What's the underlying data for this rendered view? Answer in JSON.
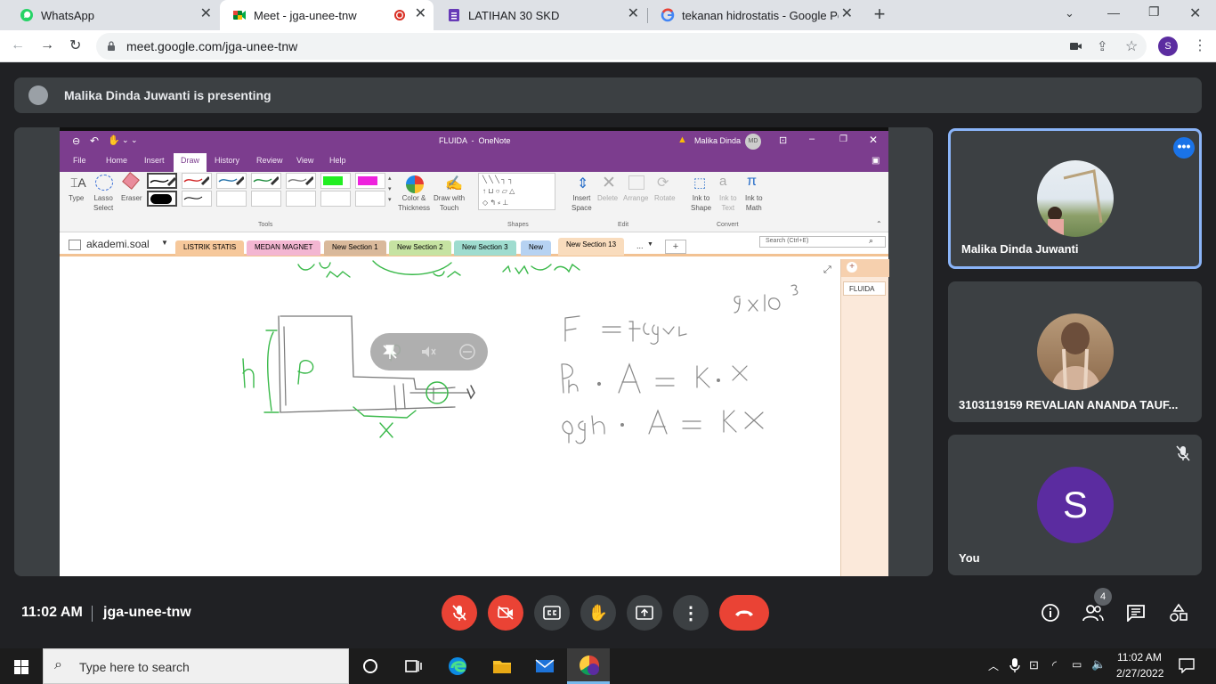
{
  "browser": {
    "tabs": [
      {
        "title": "WhatsApp",
        "icon": "whatsapp-icon"
      },
      {
        "title": "Meet - jga-unee-tnw",
        "icon": "google-meet-icon",
        "active": true,
        "recording": true
      },
      {
        "title": "LATIHAN 30 SKD",
        "icon": "google-forms-icon"
      },
      {
        "title": "tekanan hidrostatis - Google Pen",
        "icon": "google-icon"
      }
    ],
    "new_tab": "+",
    "url": "meet.google.com/jga-unee-tnw",
    "profile_initial": "S"
  },
  "meet": {
    "presenting_text": "Malika Dinda Juwanti is presenting",
    "meeting_code": "jga-unee-tnw",
    "time": "11:02 AM",
    "participant_count": "4",
    "participants": [
      {
        "name": "Malika Dinda Juwanti",
        "highlighted": true
      },
      {
        "name": "3103119159 REVALIAN ANANDA TAUF..."
      },
      {
        "name": "You",
        "initial": "S",
        "muted": true
      }
    ]
  },
  "onenote": {
    "title": "FLUIDA  -  OneNote",
    "user": "Malika Dinda",
    "user_initials": "MD",
    "ribbon_tabs": [
      "File",
      "Home",
      "Insert",
      "Draw",
      "History",
      "Review",
      "View",
      "Help"
    ],
    "active_tab": "Draw",
    "tools": [
      {
        "label": "Type"
      },
      {
        "label": "Lasso\nSelect"
      },
      {
        "label": "Eraser"
      }
    ],
    "group_labels": [
      "Tools",
      "Shapes",
      "Edit",
      "Convert"
    ],
    "color_thickness": "Color &\nThickness",
    "draw_with_touch": "Draw with\nTouch",
    "insert_space": "Insert\nSpace",
    "delete": "Delete",
    "arrange": "Arrange",
    "rotate": "Rotate",
    "ink_to_shape": "Ink to\nShape",
    "ink_to_text": "Ink to\nText",
    "ink_to_math": "Ink to\nMath",
    "notebook": "akademi.soal",
    "sections": [
      {
        "label": "LISTRIK STATIS",
        "color": "#f6c89b"
      },
      {
        "label": "MEDAN MAGNET",
        "color": "#f3b6d2"
      },
      {
        "label": "New Section 1",
        "color": "#d9b99b"
      },
      {
        "label": "New Section 2",
        "color": "#c6e3a2"
      },
      {
        "label": "New Section 3",
        "color": "#9fdccf"
      },
      {
        "label": "New",
        "color": "#b6d2f2"
      },
      {
        "label": "New Section 13",
        "color": "#f9dcbd",
        "active": true
      }
    ],
    "more_sections": "...",
    "search_placeholder": "Search (Ctrl+E)",
    "page_title": "FLUIDA"
  },
  "taskbar": {
    "search_placeholder": "Type here to search",
    "clock_time": "11:02 AM",
    "clock_date": "2/27/2022"
  }
}
